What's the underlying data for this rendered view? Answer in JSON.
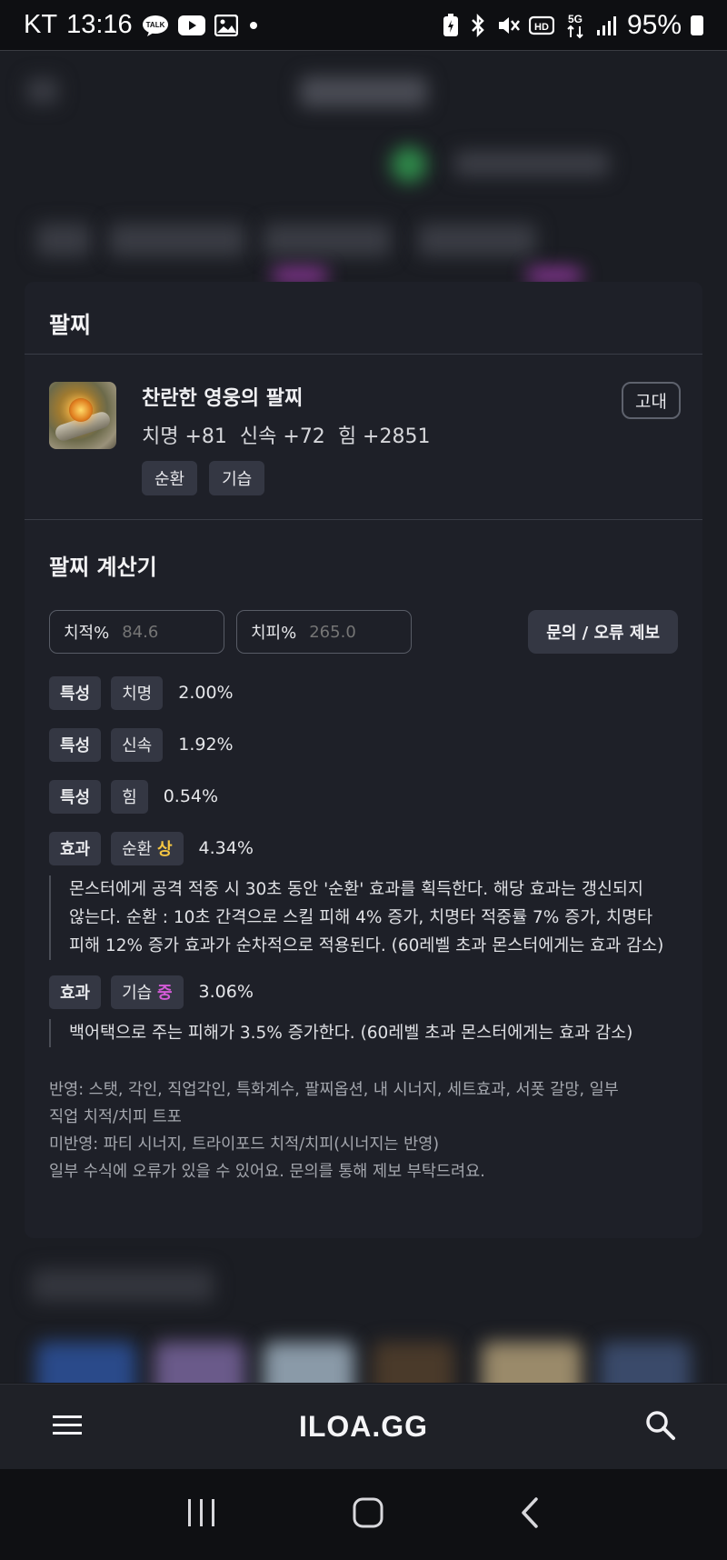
{
  "status_bar": {
    "carrier": "KT",
    "time": "13:16",
    "battery": "95%"
  },
  "app_bar": {
    "logo": "ILOA.GG",
    "menu_icon": "menu-icon",
    "search_icon": "search-icon"
  },
  "modal": {
    "title": "팔찌",
    "item": {
      "name": "찬란한 영웅의 팔찌",
      "grade": "고대",
      "stats": [
        "치명 +81",
        "신속 +72",
        "힘 +2851"
      ],
      "tags": [
        "순환",
        "기습"
      ]
    },
    "calculator": {
      "title": "팔찌 계산기",
      "crit_rate_label": "치적%",
      "crit_rate_value": "84.6",
      "crit_dmg_label": "치피%",
      "crit_dmg_value": "265.0",
      "report_button": "문의 / 오류 제보",
      "rows": [
        {
          "kind": "특성",
          "name": "치명",
          "value": "2.00%"
        },
        {
          "kind": "특성",
          "name": "신속",
          "value": "1.92%"
        },
        {
          "kind": "특성",
          "name": "힘",
          "value": "0.54%"
        }
      ],
      "effects": [
        {
          "kind": "효과",
          "name": "순환",
          "tier": "상",
          "value": "4.34%",
          "desc": [
            "몬스터에게 공격 적중 시 30초 동안 '순환' 효과를 획득한다. 해당 효과는 갱신되지",
            "않는다. 순환 : 10초 간격으로 스킬 피해 4% 증가, 치명타 적중률 7% 증가, 치명타",
            "피해 12% 증가 효과가 순차적으로 적용된다. (60레벨 초과 몬스터에게는 효과 감소)"
          ]
        },
        {
          "kind": "효과",
          "name": "기습",
          "tier": "중",
          "value": "3.06%",
          "desc": [
            "백어택으로 주는 피해가 3.5% 증가한다. (60레벨 초과 몬스터에게는 효과 감소)"
          ]
        }
      ],
      "notes": [
        "반영: 스탯, 각인, 직업각인, 특화계수, 팔찌옵션, 내 시너지, 세트효과, 서폿 갈망, 일부",
        "직업 치적/치피 트포",
        "미반영: 파티 시너지, 트라이포드 치적/치피(시너지는 반영)",
        "일부 수식에 오류가 있을 수 있어요. 문의를 통해 제보 부탁드려요."
      ]
    }
  },
  "colors": {
    "tier_high": "#f4c542",
    "tier_mid": "#d45bd8",
    "card_bg": "#1e2028",
    "chip_bg": "#343743"
  }
}
